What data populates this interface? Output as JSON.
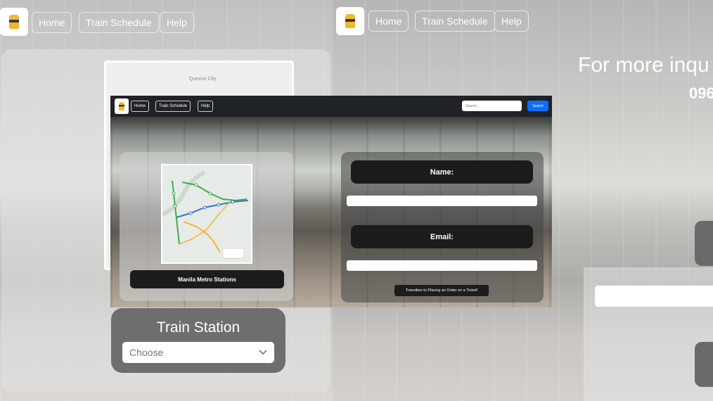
{
  "background_left": {
    "nav": [
      "Home",
      "Train Schedule",
      "Help"
    ],
    "map_thumbnail_label": "Quezon City",
    "train_station": {
      "title": "Train Station",
      "select_value": "Choose"
    }
  },
  "background_right": {
    "nav": [
      "Home",
      "Train Schedule",
      "Help"
    ],
    "inquiry_title": "For more inqu",
    "inquiry_phone": "096"
  },
  "main_window": {
    "nav": [
      "Home",
      "Train Schedule",
      "Help"
    ],
    "search_placeholder": "Search...",
    "search_button": "Search",
    "map_caption": "Manila Metro Stations",
    "form": {
      "name_label": "Name:",
      "email_label": "Email:",
      "transition_button": "Transition to Placing an Order on a Ticket!"
    }
  },
  "colors": {
    "navbar_dark": "#1f2326",
    "search_button": "#0d6efd",
    "pill_dark": "#1c1c1c",
    "metro_line_green": "#3fae49",
    "metro_line_blue": "#3b6fd8",
    "metro_line_yellow": "#f2b632"
  },
  "icons": {
    "logo": "train-icon",
    "select_arrow": "chevron-down-icon"
  }
}
